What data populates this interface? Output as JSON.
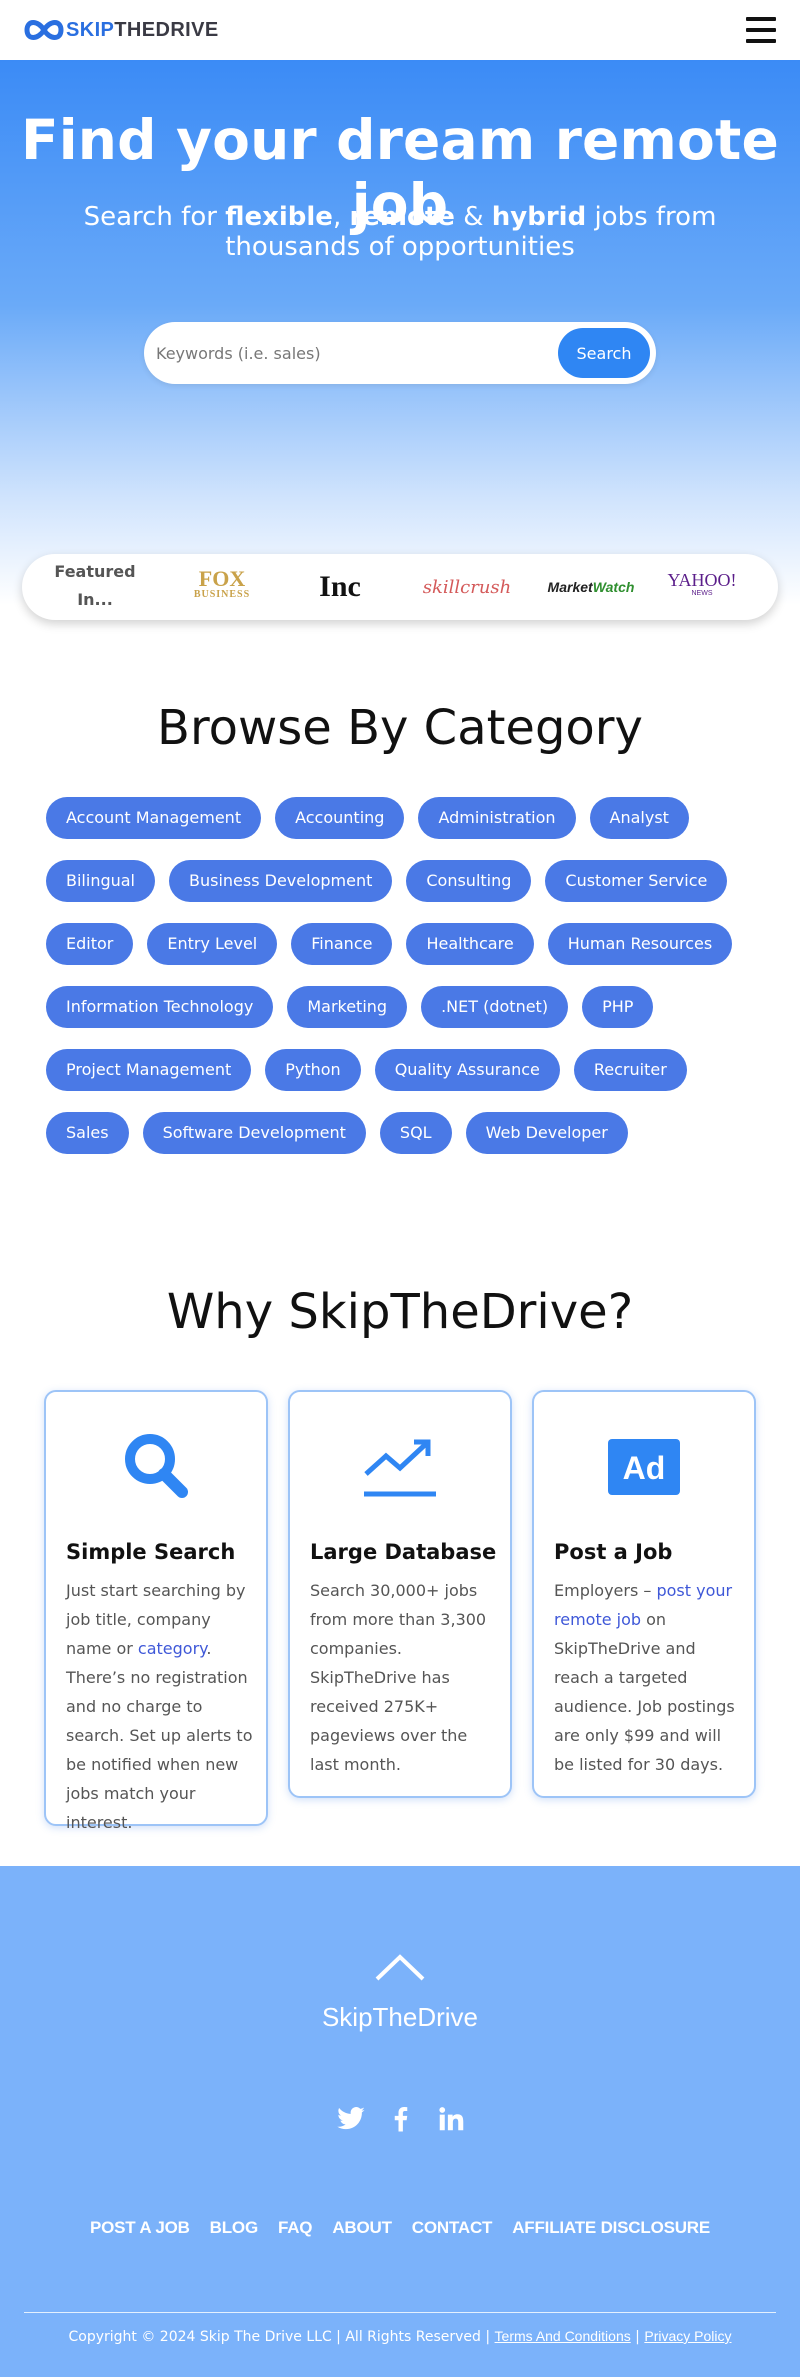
{
  "header": {
    "logo_skip": "SKIP",
    "logo_the": "THE",
    "logo_drive": "DRIVE"
  },
  "hero": {
    "title": "Find your dream remote job",
    "sub_prefix": "Search for ",
    "sub_flexible": "flexible",
    "sub_comma": ", ",
    "sub_remote": "remote",
    "sub_amp": " & ",
    "sub_hybrid": "hybrid",
    "sub_suffix": " jobs from thousands of opportunities",
    "search_placeholder": "Keywords (i.e. sales)",
    "search_button": "Search"
  },
  "featured": {
    "label": "Featured In...",
    "outlets": [
      "FOX",
      "BUSINESS",
      "Inc",
      "skillcrush",
      "Market",
      "Watch",
      "YAHOO!",
      "NEWS"
    ]
  },
  "categories": {
    "title": "Browse By Category",
    "items": [
      "Account Management",
      "Accounting",
      "Administration",
      "Analyst",
      "Bilingual",
      "Business Development",
      "Consulting",
      "Customer Service",
      "Editor",
      "Entry Level",
      "Finance",
      "Healthcare",
      "Human Resources",
      "Information Technology",
      "Marketing",
      ".NET (dotnet)",
      "PHP",
      "Project Management",
      "Python",
      "Quality Assurance",
      "Recruiter",
      "Sales",
      "Software Development",
      "SQL",
      "Web Developer"
    ]
  },
  "why": {
    "title": "Why SkipTheDrive?",
    "cards": [
      {
        "icon": "magnifier-icon",
        "title": "Simple Search",
        "text_1": "Just start searching by job title, company name or ",
        "link": "category",
        "text_2": ". There’s no registration and no charge to search. Set up alerts to be notified when new jobs match your interest."
      },
      {
        "icon": "trending-up-icon",
        "title": "Large Database",
        "text_1": "Search 30,000+ jobs from more than 3,300 companies. SkipTheDrive has received 275K+ pageviews over the last month."
      },
      {
        "icon": "ad-icon",
        "title": "Post a Job",
        "text_1": "Employers – ",
        "link": "post your remote job",
        "text_2": " on SkipTheDrive and reach a targeted audience. Job postings are only $99 and will be listed for 30 days."
      }
    ]
  },
  "footer": {
    "brand": "SkipTheDrive",
    "nav": [
      "POST A JOB",
      "BLOG",
      "FAQ",
      "ABOUT",
      "CONTACT",
      "AFFILIATE DISCLOSURE"
    ],
    "copyright": "Copyright © 2024 Skip The Drive LLC | All Rights Reserved | ",
    "terms": "Terms And Conditions",
    "sep": " | ",
    "privacy": "Privacy Policy"
  },
  "colors": {
    "accent": "#2f86f3",
    "chip": "#4a79e6",
    "footer": "#7bb2fa"
  }
}
